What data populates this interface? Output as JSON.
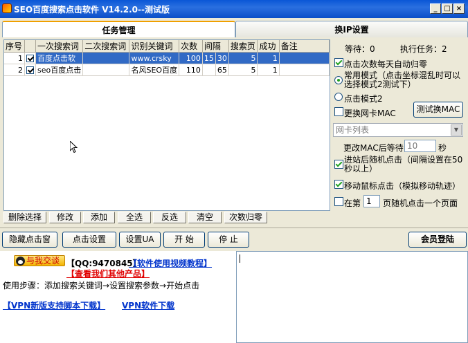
{
  "window": {
    "title": "SEO百度搜索点击软件 V14.2.0--测试版"
  },
  "tabs": [
    {
      "label": "任务管理"
    },
    {
      "label": "换IP设置"
    }
  ],
  "grid": {
    "headers": [
      "序号",
      "",
      "一次搜索词",
      "二次搜索词",
      "识别关键词",
      "次数",
      "间隔",
      "",
      "搜索页",
      "成功",
      "备注"
    ],
    "rows": [
      {
        "idx": "1",
        "checked": true,
        "kw1": "百度点击软",
        "kw2": "",
        "ident": "www.crsky",
        "count": "100",
        "int1": "15",
        "int2": "30",
        "page": "5",
        "success": "1",
        "note": ""
      },
      {
        "idx": "2",
        "checked": true,
        "kw1": "seo百度点击",
        "kw2": "",
        "ident": "名风SEO百度",
        "count": "110",
        "int1": "",
        "int2": "65",
        "page": "5",
        "success": "1",
        "note": ""
      }
    ]
  },
  "grid_buttons": [
    "删除选择",
    "修改",
    "添加",
    "全选",
    "反选",
    "清空",
    "次数归零"
  ],
  "right_panel": {
    "waiting": "等待：0",
    "executing": "执行任务：2",
    "reset_daily": "点击次数每天自动归零",
    "normal_mode": "常用模式（点击坐标混乱时可以选择模式2测试下）",
    "normal_mode_line1": "常用模式（点击坐标混乱时可以",
    "normal_mode_line2": "选择模式2测试下）",
    "mode2": "点击模式2",
    "change_mac": "更换网卡MAC",
    "test_mac_button": "测试换MAC",
    "nic_list_placeholder": "网卡列表",
    "wait_after_mac_label": "更改MAC后等待：",
    "wait_after_mac_value": "10",
    "seconds": "秒",
    "random_click_line1": "进站后随机点击（间隔设置在50",
    "random_click_line2": "秒以上）",
    "move_mouse": "移动鼠标点击（模拟移动轨迹）",
    "page_prefix": "在第",
    "page_value": "1",
    "page_suffix": "页随机点击一个页面",
    "member_login": "会员登陆"
  },
  "bottom_buttons": [
    "隐藏点击窗",
    "点击设置",
    "设置UA",
    "开  始",
    "停  止"
  ],
  "info": {
    "qq_badge": "与我交谈",
    "qq_number": "【QQ:9470845】",
    "tutorial": "【软件使用视频教程】",
    "other_products": "【查看我们其他产品】",
    "steps": "使用步骤：添加搜索关键词→设置搜索参数→开始点击",
    "vpn_script": "【VPN新版支持脚本下载】",
    "vpn_software": "VPN软件下载"
  },
  "colors": {
    "titlebar": "#0a57d6",
    "selection": "#316ac5",
    "link": "#0033cc",
    "red_link": "#e00000"
  }
}
